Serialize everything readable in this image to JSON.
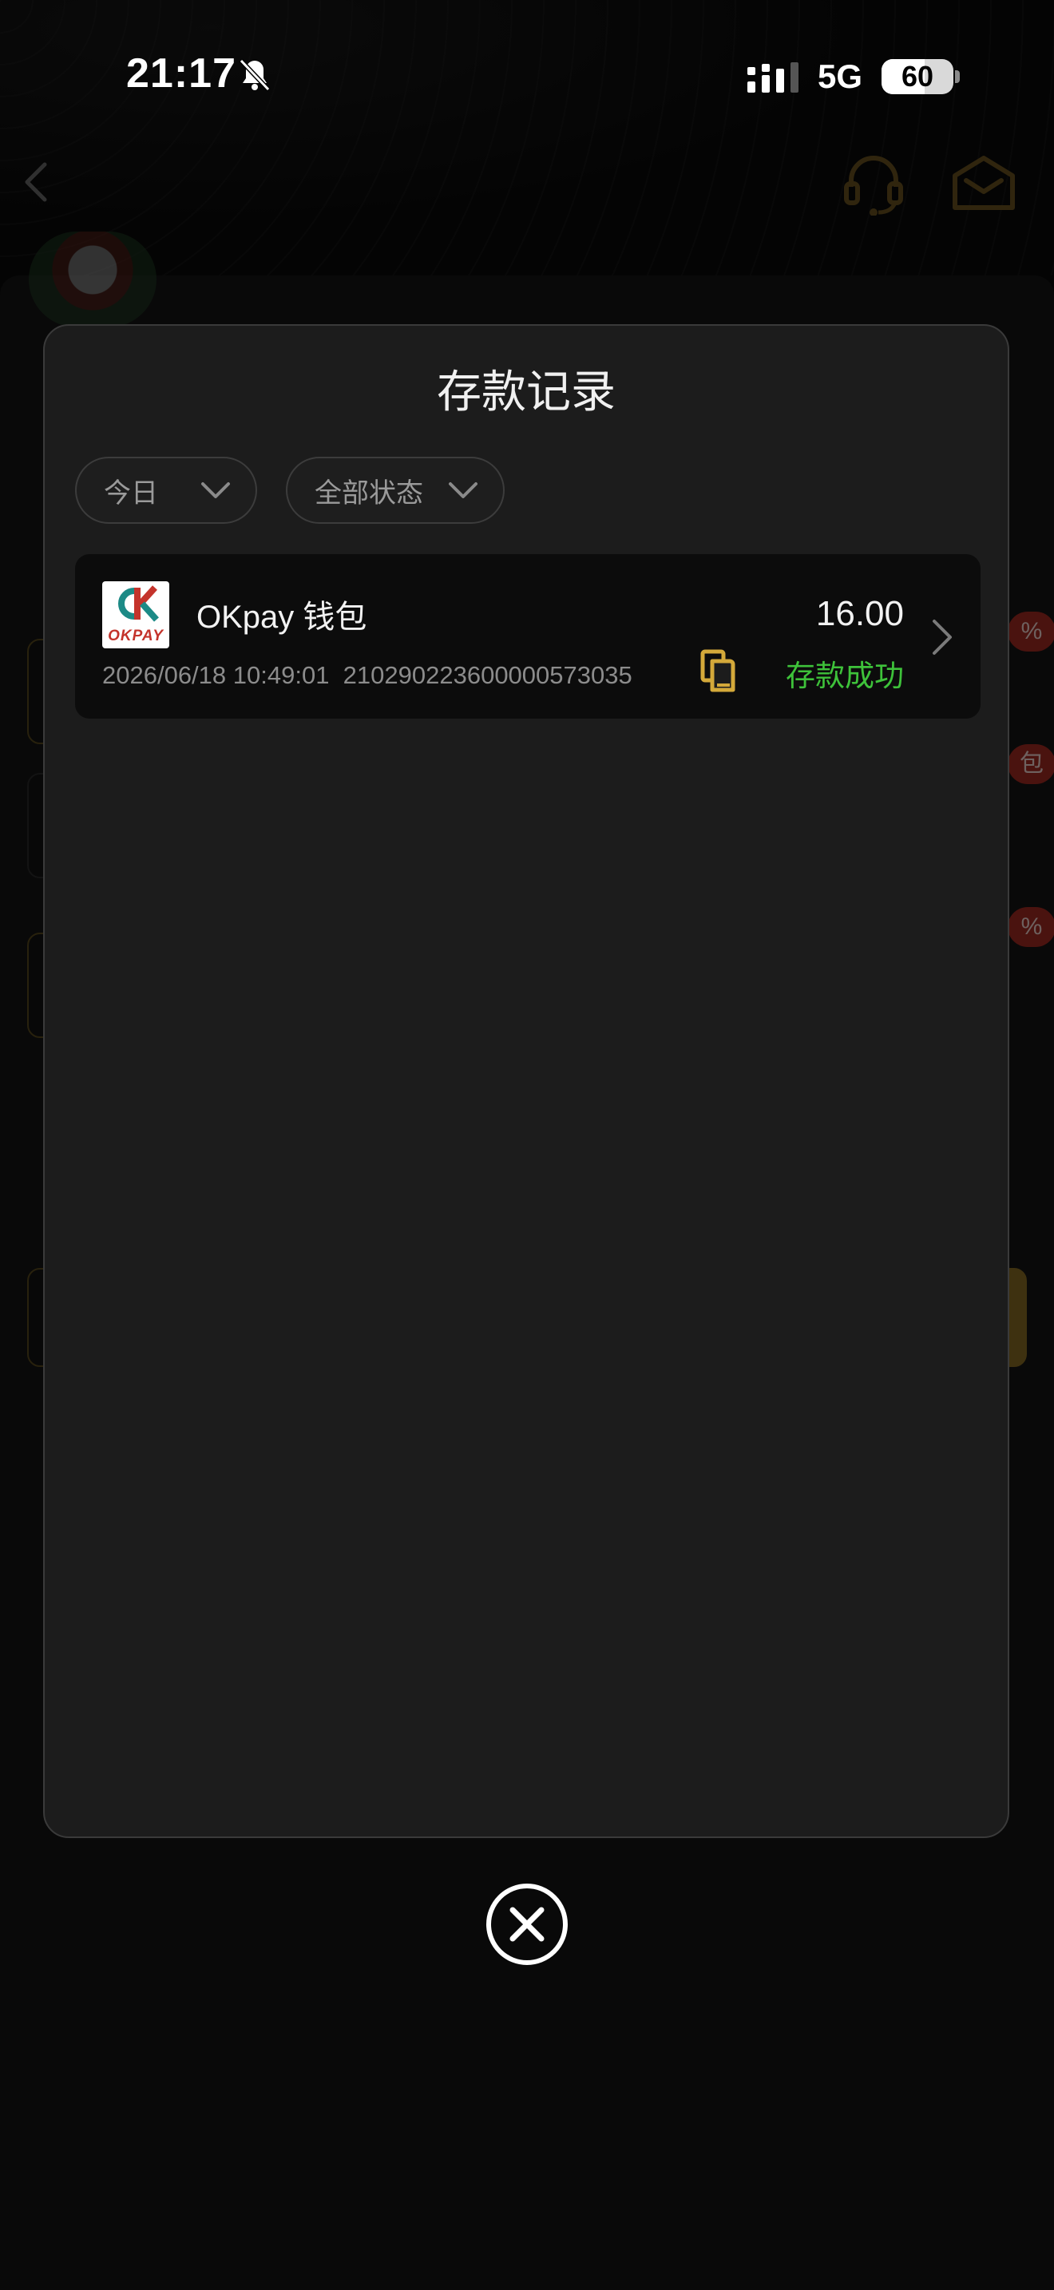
{
  "status_bar": {
    "time": "21:17",
    "network": "5G",
    "battery": "60",
    "battery_level": 0.6
  },
  "modal": {
    "title": "存款记录",
    "filters": [
      {
        "label": "今日"
      },
      {
        "label": "全部状态"
      }
    ],
    "records": [
      {
        "logo_text": "OKPAY",
        "name": "OKpay 钱包",
        "datetime": "2026/06/18 10:49:01",
        "order_id": "210290223600000573035",
        "amount": "16.00",
        "status": "存款成功",
        "status_color": "#3ec23a"
      }
    ]
  },
  "colors": {
    "accent_gold": "#d4a93a",
    "success_green": "#3ec23a",
    "badge_red": "#a52b22"
  },
  "icons": [
    "bell-muted-icon",
    "signal-icon",
    "back-icon",
    "headset-icon",
    "mail-icon",
    "chevron-down-icon",
    "copy-icon",
    "chevron-right-icon",
    "close-icon"
  ],
  "background_fragments": {
    "badge": "%",
    "badge_alt": "包"
  }
}
